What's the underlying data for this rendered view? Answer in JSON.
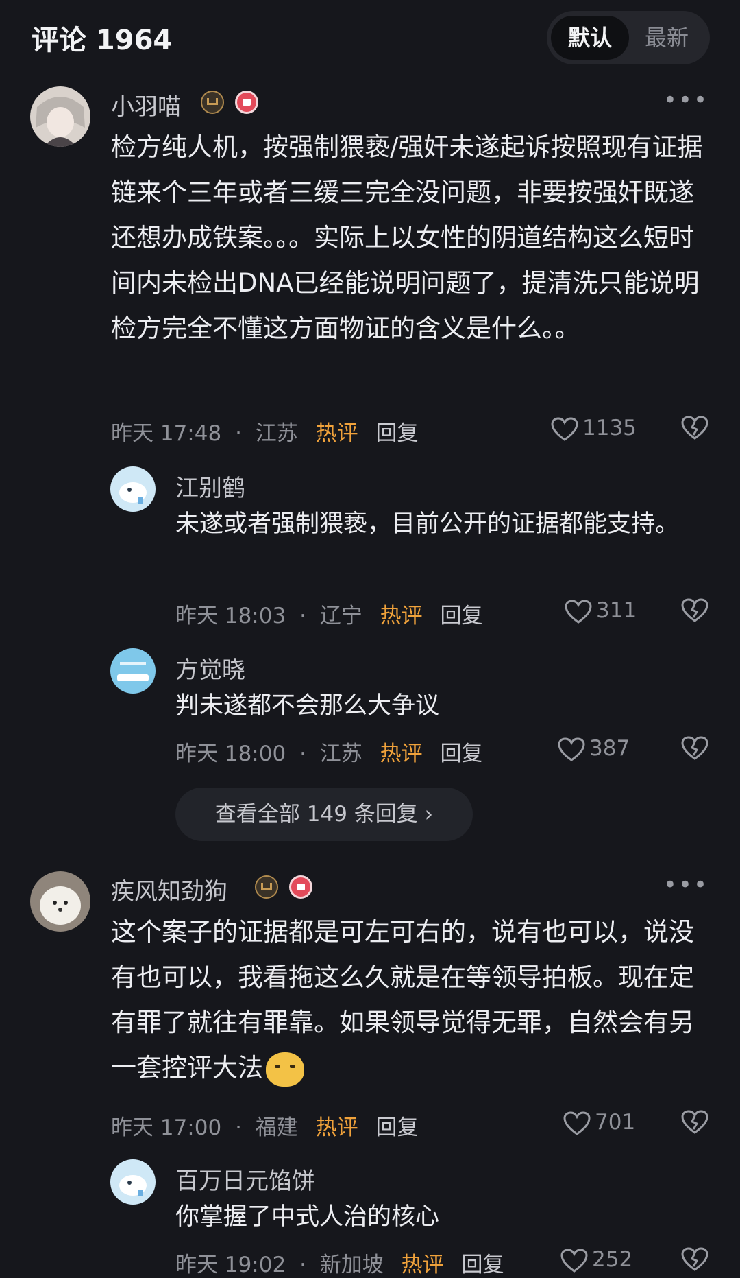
{
  "header": {
    "title": "评论 1964",
    "sort_default": "默认",
    "sort_latest": "最新"
  },
  "comments": [
    {
      "user": "小羽喵",
      "text": "检方纯人机，按强制猥亵/强奸未遂起诉按照现有证据链来个三年或者三缓三完全没问题，非要按强奸既遂还想办成铁案。。。实际上以女性的阴道结构这么短时间内未检出DNA已经能说明问题了，提清洗只能说明检方完全不懂这方面物证的含义是什么。。",
      "time": "昨天 17:48",
      "sep": "·",
      "location": "江苏",
      "hot": "热评",
      "reply": "回复",
      "likes": "1135",
      "replies": [
        {
          "user": "江别鹤",
          "text": "未遂或者强制猥亵，目前公开的证据都能支持。",
          "time": "昨天 18:03",
          "sep": "·",
          "location": "辽宁",
          "hot": "热评",
          "reply": "回复",
          "likes": "311"
        },
        {
          "user": "方觉晓",
          "text": "判未遂都不会那么大争议",
          "time": "昨天 18:00",
          "sep": "·",
          "location": "江苏",
          "hot": "热评",
          "reply": "回复",
          "likes": "387"
        }
      ],
      "view_all": "查看全部 149 条回复 ›"
    },
    {
      "user": "疾风知劲狗",
      "text": "这个案子的证据都是可左可右的，说有也可以，说没有也可以，我看拖这么久就是在等领导拍板。现在定有罪了就往有罪靠。如果领导觉得无罪，自然会有另一套控评大法",
      "time": "昨天 17:00",
      "sep": "·",
      "location": "福建",
      "hot": "热评",
      "reply": "回复",
      "likes": "701",
      "replies": [
        {
          "user": "百万日元馅饼",
          "text": "你掌握了中式人治的核心",
          "time": "昨天 19:02",
          "sep": "·",
          "location": "新加坡",
          "hot": "热评",
          "reply": "回复",
          "likes": "252"
        }
      ]
    }
  ],
  "icons": {
    "more": "more-icon",
    "like": "heart-icon",
    "dislike": "broken-heart-icon",
    "crown": "crown-badge-icon",
    "thumb": "like-badge-icon"
  },
  "colors": {
    "background": "#16171c",
    "hot": "#f0a23b",
    "text": "#ecedf1",
    "meta": "#8f9198"
  }
}
